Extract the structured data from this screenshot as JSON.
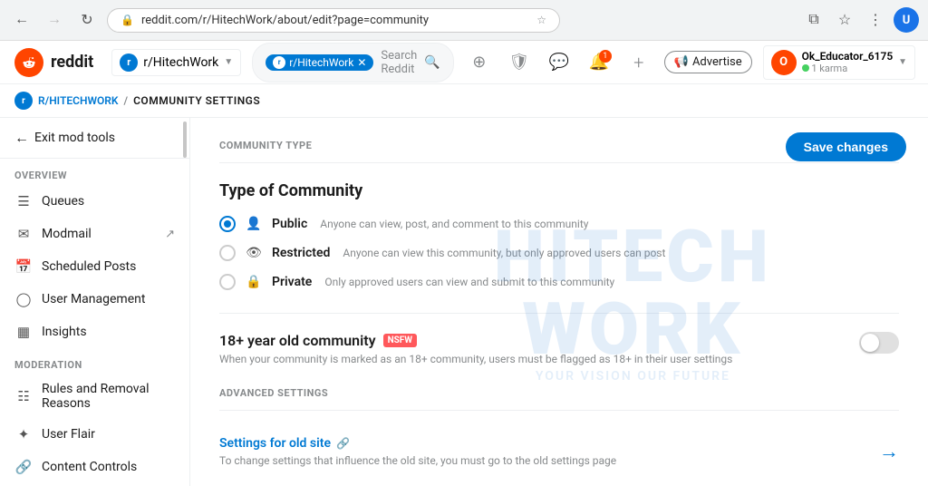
{
  "browser": {
    "url": "reddit.com/r/HitechWork/about/edit?page=community",
    "back_disabled": false,
    "forward_disabled": true
  },
  "header": {
    "logo_text": "reddit",
    "subreddit": "r/HitechWork",
    "subreddit_initial": "r",
    "search_tag": "r/HitechWork",
    "search_placeholder": "Search Reddit",
    "advertise_label": "Advertise",
    "user_name": "Ok_Educator_6175",
    "user_karma": "1 karma",
    "notification_count": "1",
    "add_btn": "+"
  },
  "breadcrumb": {
    "subreddit": "R/HITECHWORK",
    "separator": "/",
    "page": "COMMUNITY SETTINGS"
  },
  "sidebar": {
    "exit_label": "Exit mod tools",
    "overview_title": "OVERVIEW",
    "moderation_title": "MODERATION",
    "items": [
      {
        "id": "queues",
        "label": "Queues",
        "icon": "☰"
      },
      {
        "id": "modmail",
        "label": "Modmail",
        "icon": "✉",
        "has_external": true
      },
      {
        "id": "scheduled-posts",
        "label": "Scheduled Posts",
        "icon": "📅"
      },
      {
        "id": "user-management",
        "label": "User Management",
        "icon": "👤"
      },
      {
        "id": "insights",
        "label": "Insights",
        "icon": "📊"
      },
      {
        "id": "rules",
        "label": "Rules and Removal Reasons",
        "icon": "📋"
      },
      {
        "id": "user-flair",
        "label": "User Flair",
        "icon": "🏷"
      },
      {
        "id": "content-controls",
        "label": "Content Controls",
        "icon": "🔗"
      }
    ]
  },
  "content": {
    "save_changes_label": "Save changes",
    "community_type_heading": "COMMUNITY TYPE",
    "type_of_community_label": "Type of Community",
    "radio_options": [
      {
        "id": "public",
        "label": "Public",
        "description": "Anyone can view, post, and comment to this community",
        "selected": true,
        "icon": "👤"
      },
      {
        "id": "restricted",
        "label": "Restricted",
        "description": "Anyone can view this community, but only approved users can post",
        "selected": false,
        "icon": "👁"
      },
      {
        "id": "private",
        "label": "Private",
        "description": "Only approved users can view and submit to this community",
        "selected": false,
        "icon": "🔒"
      }
    ],
    "nsfw_title": "18+ year old community",
    "nsfw_badge": "NSFW",
    "nsfw_description": "When your community is marked as an 18+ community, users must be flagged as 18+ in their user settings",
    "nsfw_enabled": false,
    "advanced_heading": "ADVANCED SETTINGS",
    "settings_link_title": "Settings for old site",
    "settings_link_desc": "To change settings that influence the old site, you must go to the old settings page",
    "watermark_logo": "HITECH WORK",
    "watermark_tagline": "YOUR VISION OUR FUTURE"
  }
}
